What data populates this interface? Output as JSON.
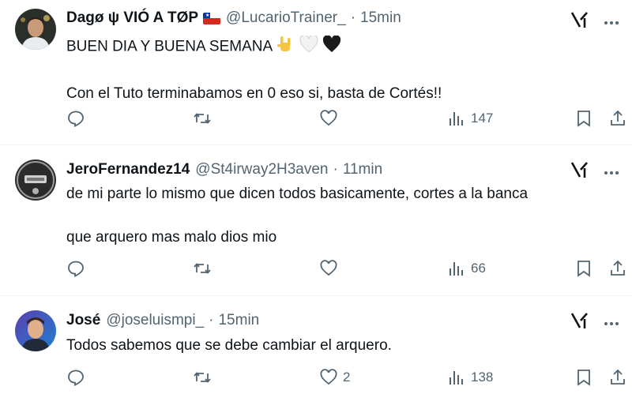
{
  "tweets": [
    {
      "name": "Dagø ψ VIÓ A TØP",
      "handle": "@LucarioTrainer_",
      "separator": "·",
      "time": "15min",
      "lines": [
        "BUEN DIA Y BUENA SEMANA",
        "",
        "Con el Tuto terminabamos en 0 eso si, basta de Cortés!!"
      ],
      "reply_count": "",
      "retweet_count": "",
      "like_count": "",
      "views": "147"
    },
    {
      "name": "JeroFernandez14",
      "handle": "@St4irway2H3aven",
      "separator": "·",
      "time": "11min",
      "lines": [
        "de mi parte lo mismo que dicen todos basicamente, cortes a la banca",
        "",
        "que arquero mas malo dios mio"
      ],
      "reply_count": "",
      "retweet_count": "",
      "like_count": "",
      "views": "66"
    },
    {
      "name": "José",
      "handle": "@joseluismpi_",
      "separator": "·",
      "time": "15min",
      "lines": [
        "Todos sabemos que se debe cambiar el arquero."
      ],
      "reply_count": "",
      "retweet_count": "",
      "like_count": "2",
      "views": "138"
    }
  ],
  "icons": {
    "grok": "grok-icon",
    "more": "more-icon",
    "reply": "reply-icon",
    "retweet": "retweet-icon",
    "like": "like-icon",
    "views": "views-icon",
    "bookmark": "bookmark-icon",
    "share": "share-icon"
  },
  "colors": {
    "text": "#0f1419",
    "secondary": "#536471",
    "divider": "#eff3f4",
    "flag_red": "#d52b1e",
    "flag_blue": "#0039a6"
  }
}
